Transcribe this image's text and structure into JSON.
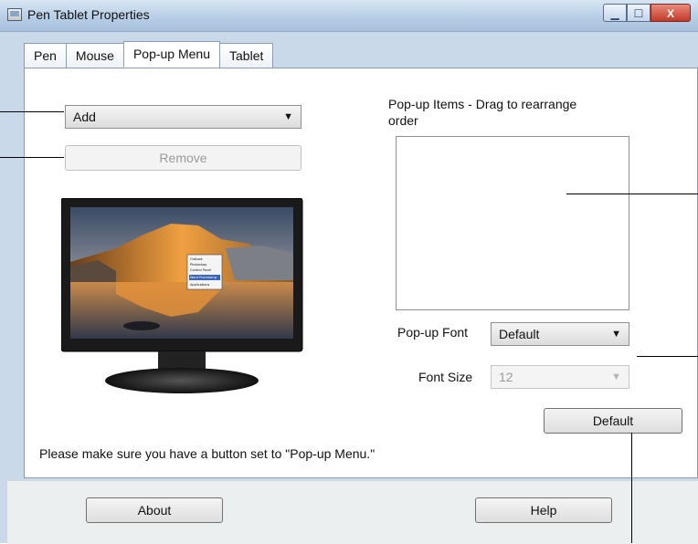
{
  "window": {
    "title": "Pen Tablet Properties"
  },
  "controls": {
    "minimize": "▁",
    "maximize": "☐",
    "close": "X"
  },
  "tabs": [
    {
      "label": "Pen",
      "active": false
    },
    {
      "label": "Mouse",
      "active": false
    },
    {
      "label": "Pop-up Menu",
      "active": true
    },
    {
      "label": "Tablet",
      "active": false
    }
  ],
  "popup_menu": {
    "add_dropdown": {
      "value": "Add"
    },
    "remove_label": "Remove",
    "items_heading_line1": "Pop-up Items - Drag to rearrange",
    "items_heading_line2": "order",
    "popup_font_label": "Pop-up Font",
    "popup_font_value": "Default",
    "font_size_label": "Font Size",
    "font_size_value": "12",
    "default_button": "Default",
    "note": "Please make sure you have a button set to \"Pop-up Menu.\"",
    "preview_menu_items": [
      "Outlook",
      "Photoshop",
      "Control Panel",
      "Word Processing",
      "Applications"
    ]
  },
  "footer": {
    "about": "About",
    "help": "Help"
  }
}
